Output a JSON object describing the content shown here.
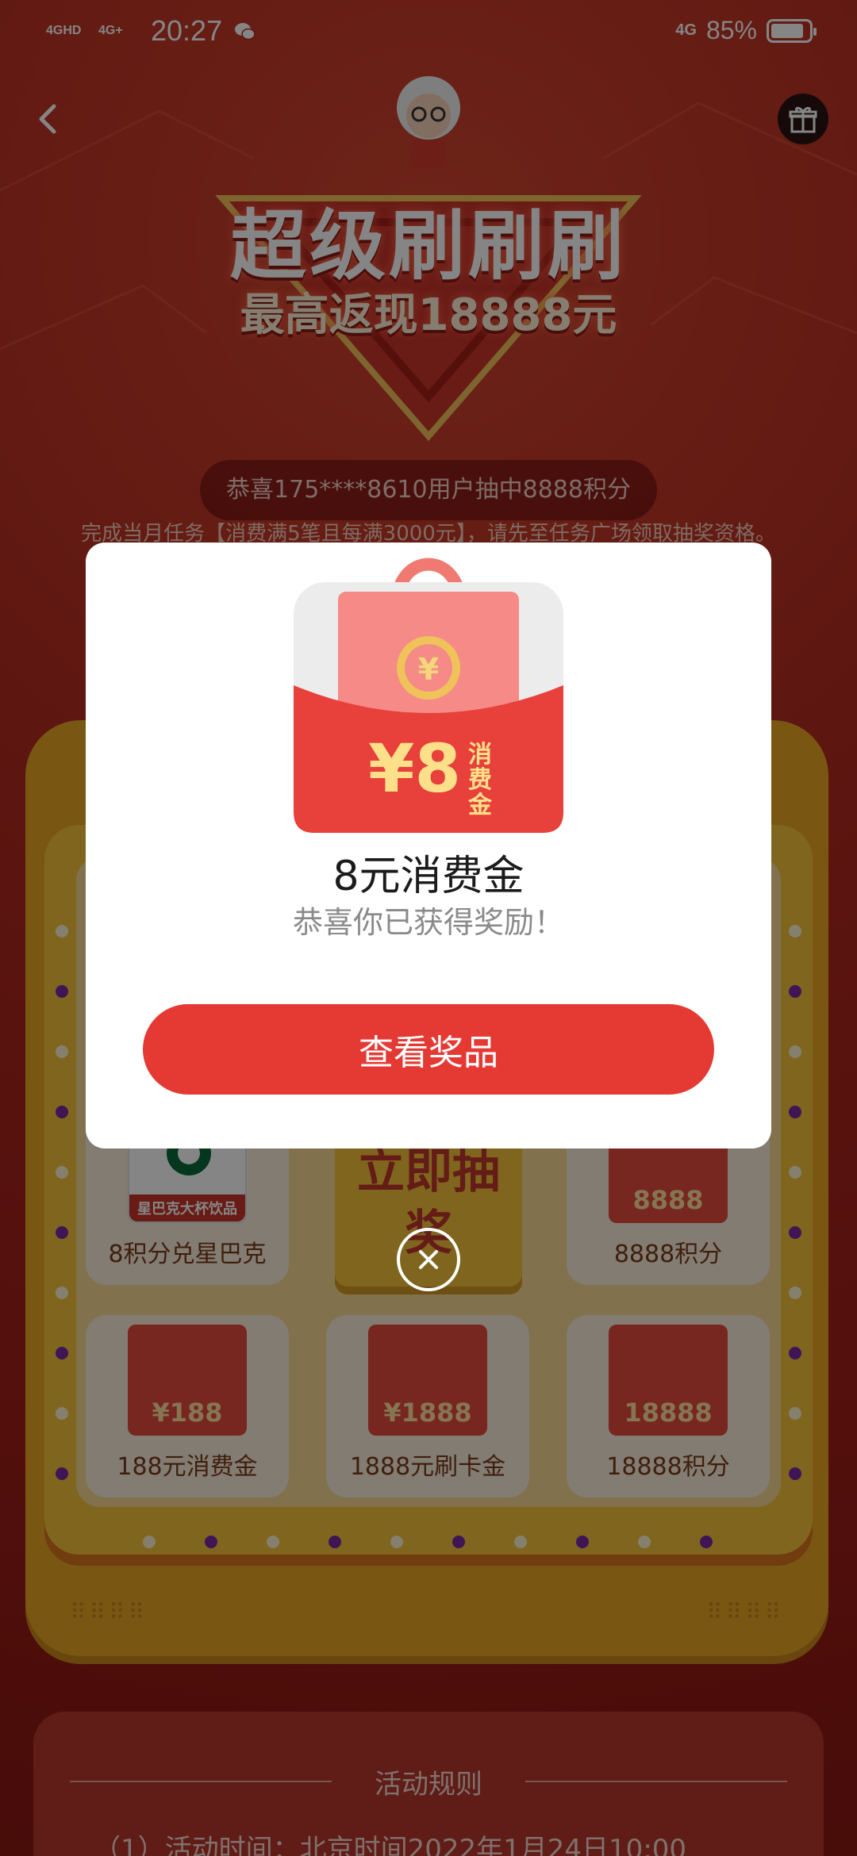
{
  "status_bar": {
    "signal_1": "4GHD",
    "signal_2": "4G+",
    "time": "20:27",
    "network": "4G",
    "battery": "85%"
  },
  "hero": {
    "title": "超级刷刷刷",
    "subtitle": "最高返现18888元"
  },
  "ticker": "恭喜175****8610用户抽中8888积分",
  "notice": "完成当月任务【消费满5笔且每满3000元】，请先至任务广场领取抽奖资格。",
  "board": {
    "draw_button": "立即抽奖",
    "cells": [
      {
        "label": "8积分兑星巴克",
        "art": "星巴克大杯饮品"
      },
      {
        "label": "8888积分",
        "art": "8888"
      },
      {
        "label": "188元消费金",
        "art": "¥188"
      },
      {
        "label": "1888元刷卡金",
        "art": "¥1888"
      },
      {
        "label": "18888积分",
        "art": "18888"
      }
    ]
  },
  "rules": {
    "title": "活动规则",
    "line1": "（1）活动时间：北京时间2022年1月24日10:00"
  },
  "modal": {
    "bag_amount": "¥8",
    "bag_tag": "消费金",
    "title": "8元消费金",
    "subtitle": "恭喜你已获得奖励！",
    "button": "查看奖品"
  },
  "colors": {
    "primary_red": "#e53a34",
    "background_red": "#a9211b",
    "board_gold": "#e9a826"
  },
  "icons": {
    "back": "chevron-left-icon",
    "gift": "gift-icon",
    "close": "close-icon"
  }
}
